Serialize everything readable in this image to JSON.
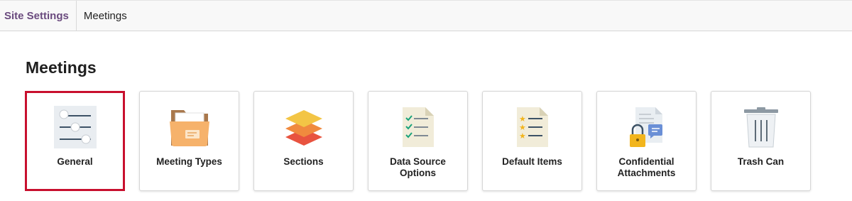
{
  "breadcrumb": {
    "items": [
      {
        "label": "Site Settings"
      },
      {
        "label": "Meetings"
      }
    ]
  },
  "page": {
    "title": "Meetings"
  },
  "tiles": [
    {
      "label": "General",
      "icon": "sliders-icon",
      "selected": true
    },
    {
      "label": "Meeting Types",
      "icon": "folder-icon",
      "selected": false
    },
    {
      "label": "Sections",
      "icon": "layers-icon",
      "selected": false
    },
    {
      "label": "Data Source Options",
      "icon": "checklist-document-icon",
      "selected": false
    },
    {
      "label": "Default Items",
      "icon": "starred-list-document-icon",
      "selected": false
    },
    {
      "label": "Confidential Attachments",
      "icon": "locked-document-icon",
      "selected": false
    },
    {
      "label": "Trash Can",
      "icon": "trash-can-icon",
      "selected": false
    }
  ],
  "colors": {
    "breadcrumb_link": "#6a4a7e",
    "selection_border": "#c8102e"
  }
}
